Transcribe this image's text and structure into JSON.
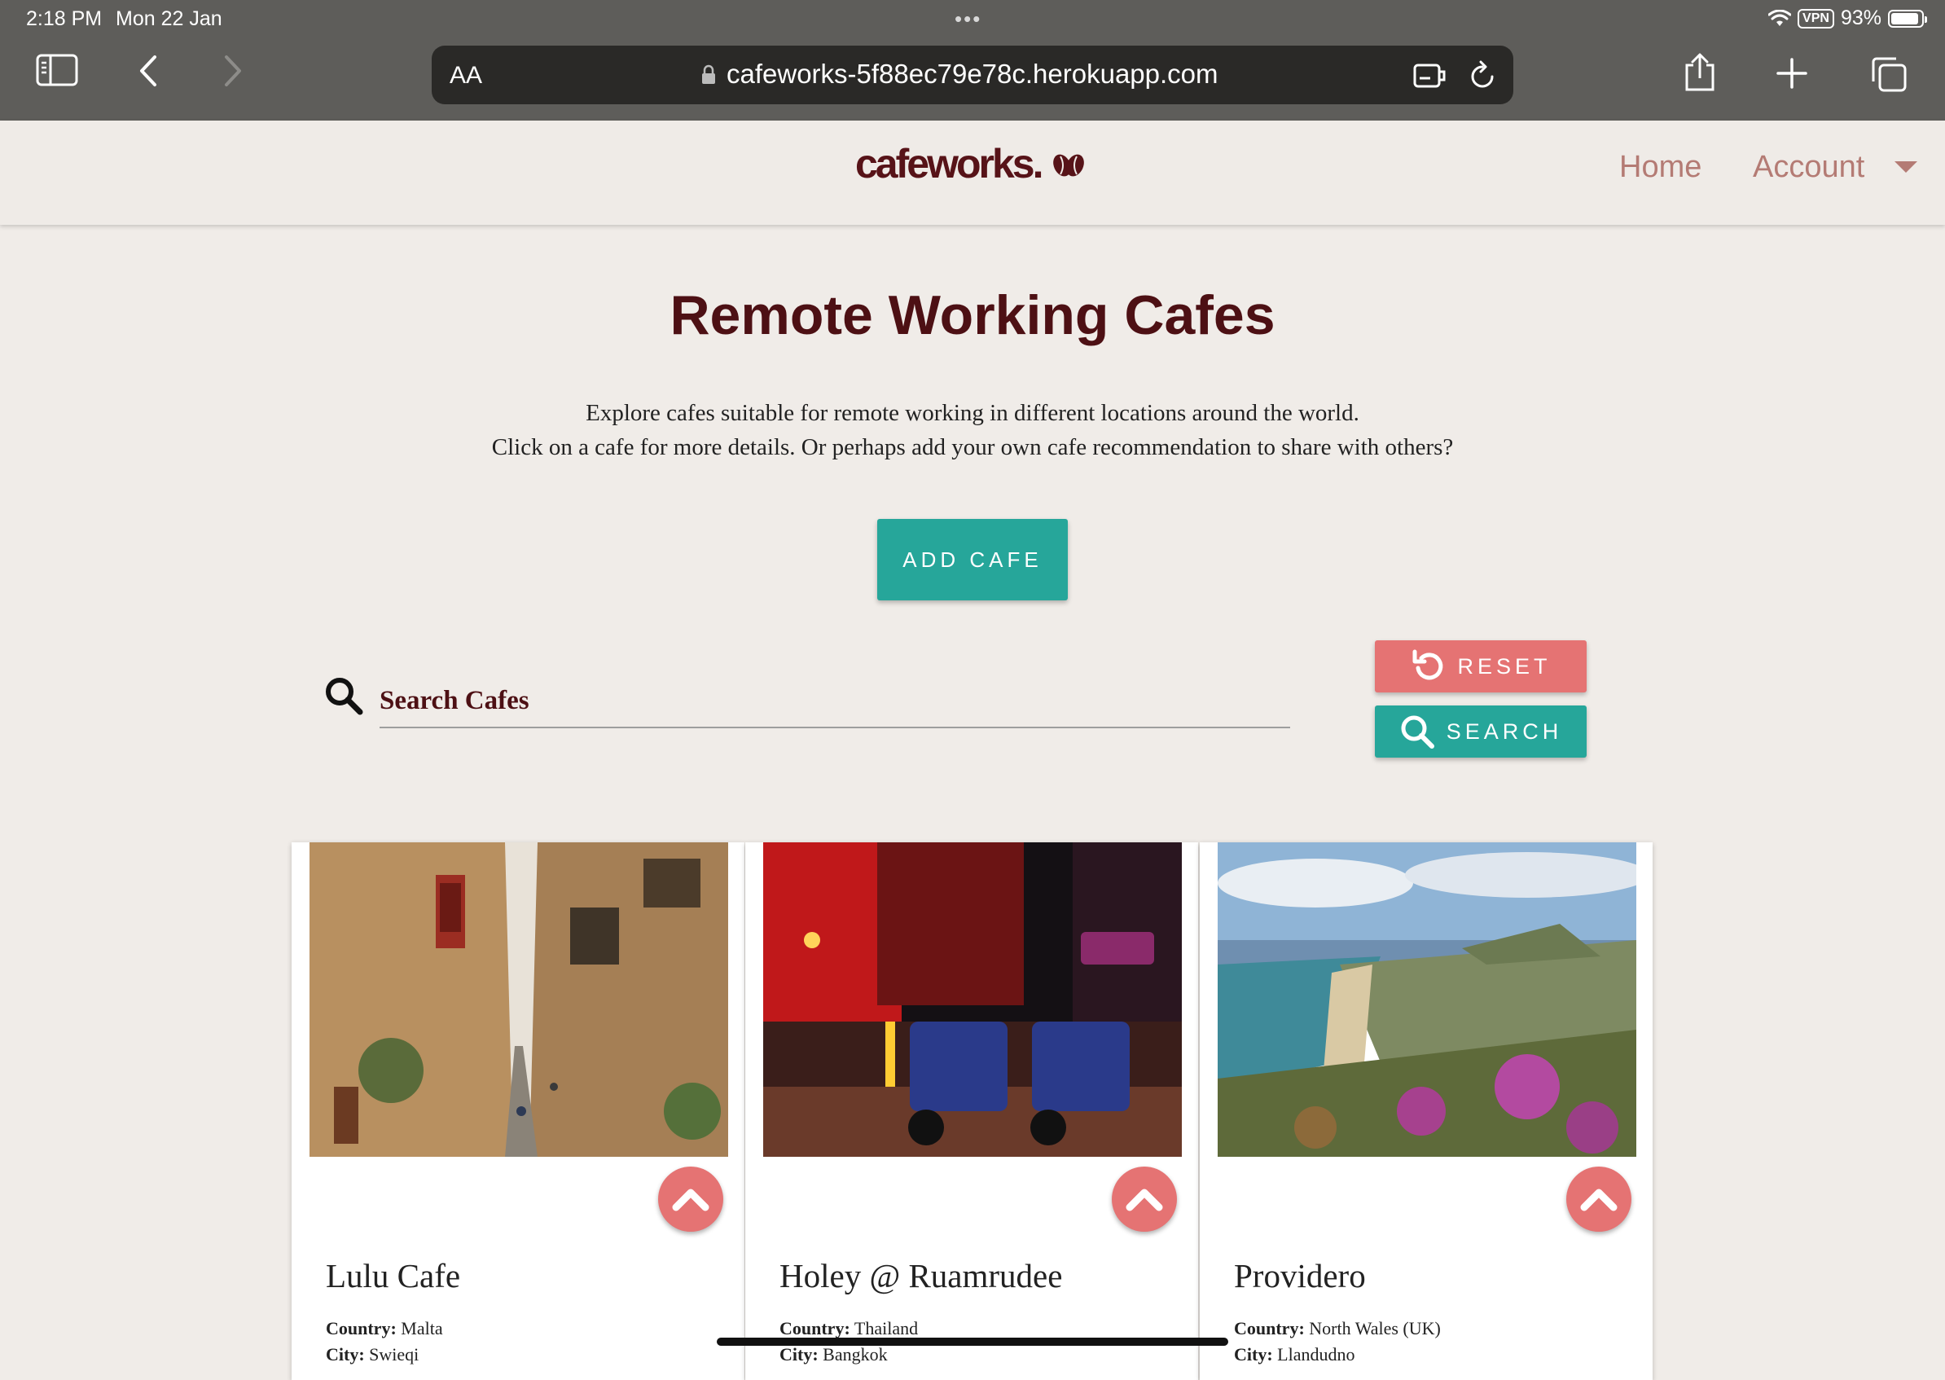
{
  "status_bar": {
    "time": "2:18 PM",
    "date": "Mon 22 Jan",
    "vpn": "VPN",
    "battery": "93%",
    "battery_level": 0.93
  },
  "browser": {
    "text_size_label": "AA",
    "url": "cafeworks-5f88ec79e78c.herokuapp.com"
  },
  "navbar": {
    "logo": "cafeworks.",
    "links": [
      "Home",
      "Account"
    ]
  },
  "main": {
    "heading": "Remote Working Cafes",
    "intro_line1": "Explore cafes suitable for remote working in different locations around the world.",
    "intro_line2": "Click on a cafe for more details. Or perhaps add your own cafe recommendation to share with others?",
    "add_cafe_label": "ADD CAFE",
    "search_placeholder": "Search Cafes",
    "reset_label": "RESET",
    "search_label": "SEARCH"
  },
  "cards": [
    {
      "name": "Lulu Cafe",
      "country_label": "Country:",
      "country": "Malta",
      "city_label": "City:",
      "city": "Swieqi"
    },
    {
      "name": "Holey @ Ruamrudee",
      "country_label": "Country:",
      "country": "Thailand",
      "city_label": "City:",
      "city": "Bangkok"
    },
    {
      "name": "Providero",
      "country_label": "Country:",
      "country": "North Wales (UK)",
      "city_label": "City:",
      "city": "Llandudno"
    }
  ],
  "colors": {
    "brand": "#571318",
    "teal": "#26a69a",
    "coral": "#e57373",
    "nav_link": "#b47b74",
    "page_bg": "#f0ece8"
  }
}
